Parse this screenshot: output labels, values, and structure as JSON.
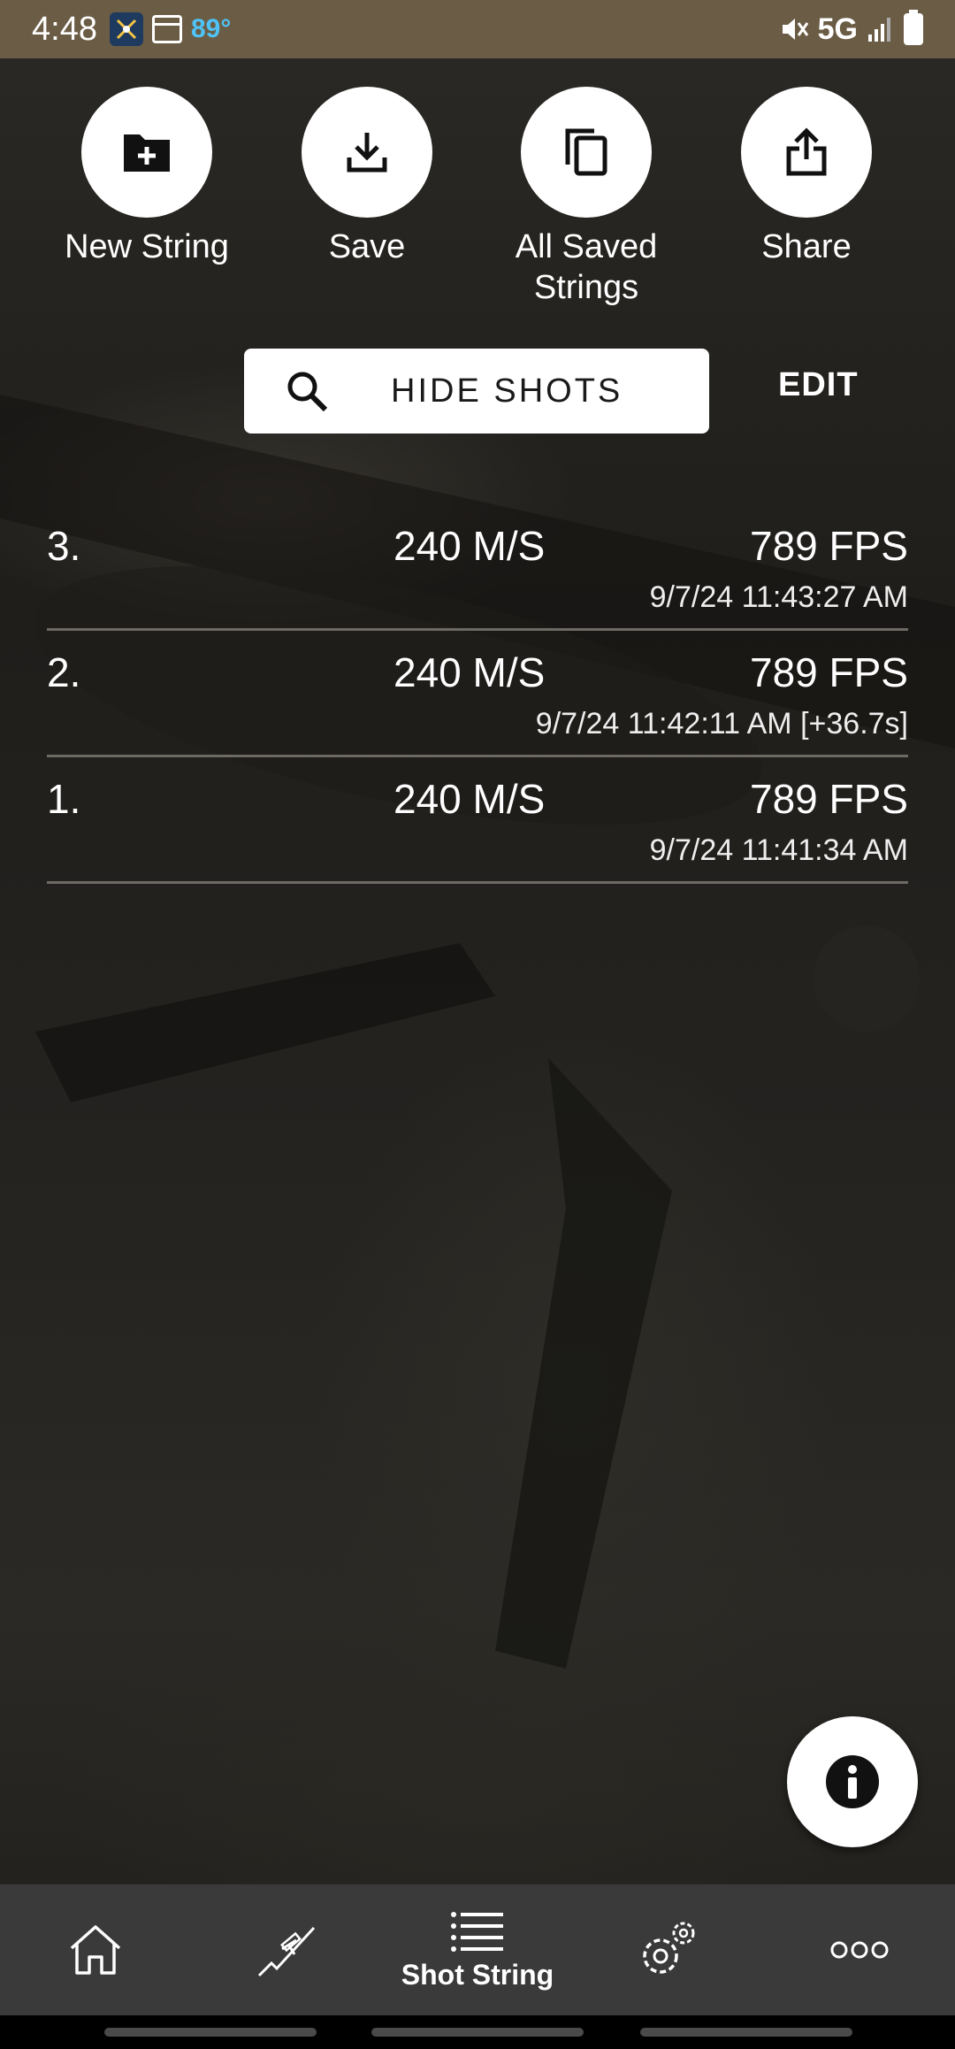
{
  "status_bar": {
    "time": "4:48",
    "temperature": "89°",
    "network": "5G"
  },
  "actions": [
    {
      "label": "New String",
      "icon": "folder-plus-icon"
    },
    {
      "label": "Save",
      "icon": "download-icon"
    },
    {
      "label": "All Saved Strings",
      "icon": "copy-icon"
    },
    {
      "label": "Share",
      "icon": "share-icon"
    }
  ],
  "search": {
    "hide_label": "HIDE SHOTS",
    "edit_label": "EDIT"
  },
  "shots": [
    {
      "num": "3.",
      "ms": "240 M/S",
      "fps": "789 FPS",
      "time": "9/7/24 11:43:27 AM"
    },
    {
      "num": "2.",
      "ms": "240 M/S",
      "fps": "789 FPS",
      "time": "9/7/24 11:42:11 AM [+36.7s]"
    },
    {
      "num": "1.",
      "ms": "240 M/S",
      "fps": "789 FPS",
      "time": "9/7/24 11:41:34 AM"
    }
  ],
  "bottom_nav": {
    "active_label": "Shot String",
    "items": [
      "home-icon",
      "rifle-icon",
      "list-icon",
      "settings-icon",
      "more-icon"
    ]
  },
  "colors": {
    "status_bar": "#6b5c45",
    "nav_bg": "#3a3a3a"
  }
}
